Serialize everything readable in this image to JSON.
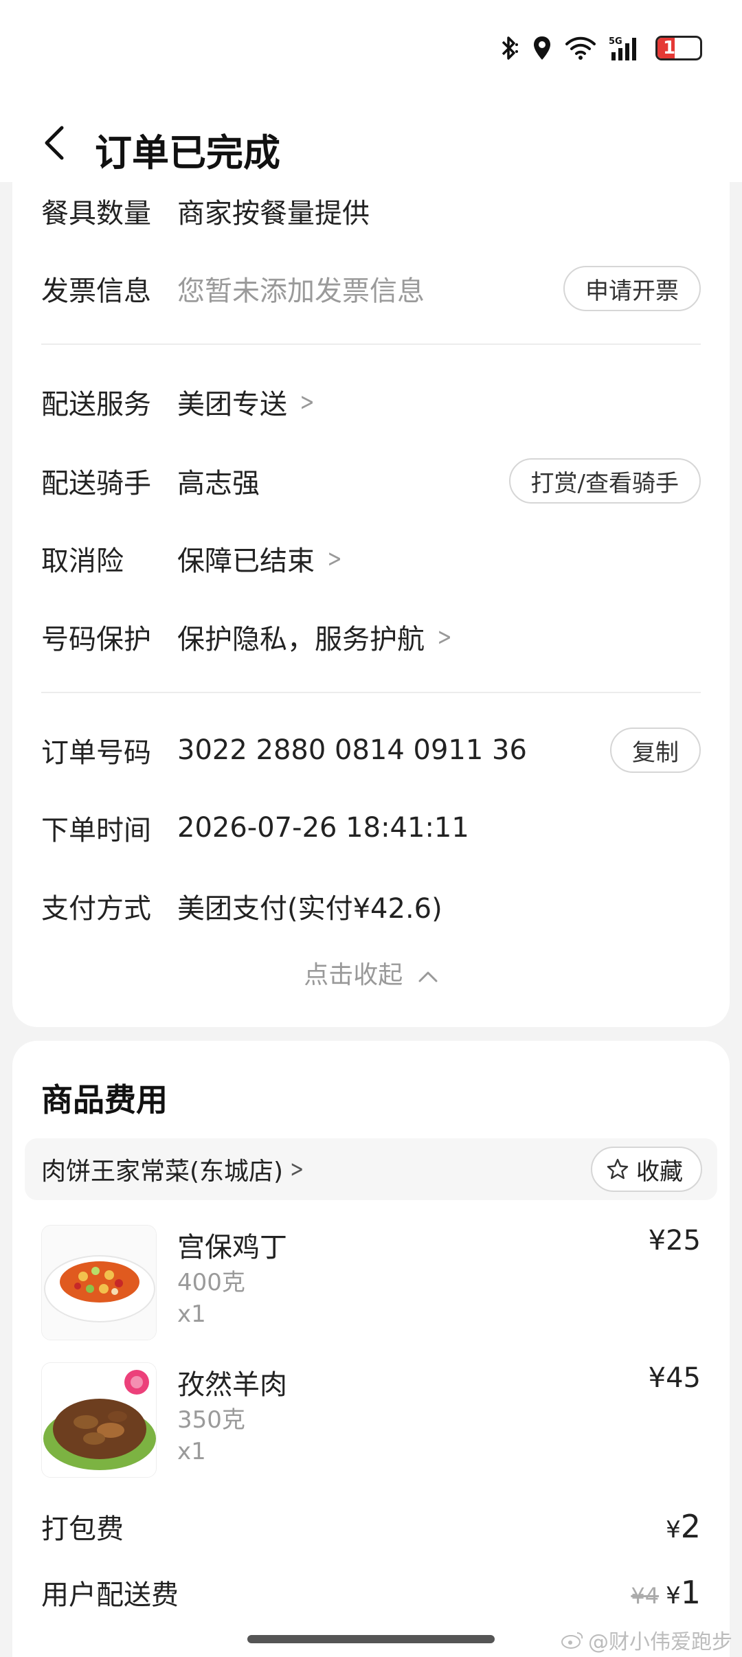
{
  "status_bar": {
    "battery": "18",
    "network": "5G"
  },
  "nav": {
    "title": "订单已完成"
  },
  "order_info": {
    "tableware": {
      "label": "餐具数量",
      "value": "商家按餐量提供"
    },
    "invoice": {
      "label": "发票信息",
      "value": "您暂未添加发票信息",
      "button": "申请开票"
    },
    "delivery_service": {
      "label": "配送服务",
      "value": "美团专送"
    },
    "rider": {
      "label": "配送骑手",
      "value": "高志强",
      "button": "打赏/查看骑手"
    },
    "cancel_insurance": {
      "label": "取消险",
      "value": "保障已结束"
    },
    "number_protect": {
      "label": "号码保护",
      "value": "保护隐私，服务护航"
    },
    "order_no": {
      "label": "订单号码",
      "value": "3022 2880 0814 0911 36",
      "button": "复制"
    },
    "order_time": {
      "label": "下单时间",
      "value": "2026-07-26 18:41:11"
    },
    "payment": {
      "label": "支付方式",
      "value": "美团支付(实付¥42.6)"
    },
    "collapse": "点击收起"
  },
  "goods": {
    "title": "商品费用",
    "store_name": "肉饼王家常菜(东城店)",
    "favorite_label": "收藏",
    "items": [
      {
        "name": "宫保鸡丁",
        "spec": "400克",
        "qty": "x1",
        "price": "¥25"
      },
      {
        "name": "孜然羊肉",
        "spec": "350克",
        "qty": "x1",
        "price": "¥45"
      }
    ],
    "packing_fee": {
      "label": "打包费",
      "yen": "¥",
      "amount": "2"
    },
    "delivery_fee": {
      "label": "用户配送费",
      "old": "¥4",
      "yen": "¥",
      "amount": "1"
    }
  },
  "watermark": "@财小伟爱跑步",
  "colors": {
    "accent_red": "#e53935",
    "muted": "#9a9a9a"
  }
}
